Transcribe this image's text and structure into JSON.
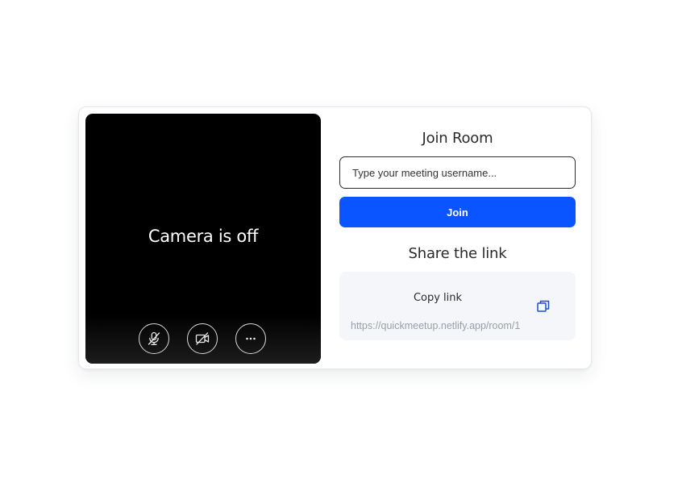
{
  "preview": {
    "status_text": "Camera is off",
    "controls": [
      {
        "name": "mic-muted-icon"
      },
      {
        "name": "camera-off-icon"
      },
      {
        "name": "more-options-icon"
      }
    ]
  },
  "join": {
    "heading": "Join Room",
    "username_placeholder": "Type your meeting username...",
    "username_value": "",
    "button_label": "Join"
  },
  "share": {
    "heading": "Share the link",
    "copy_label": "Copy link",
    "url": "https://quickmeetup.netlify.app/room/1"
  },
  "colors": {
    "accent": "#0a55ff",
    "copy_icon": "#1a4fd6",
    "preview_bg": "#000000",
    "link_box_bg": "#f4f6fa"
  }
}
